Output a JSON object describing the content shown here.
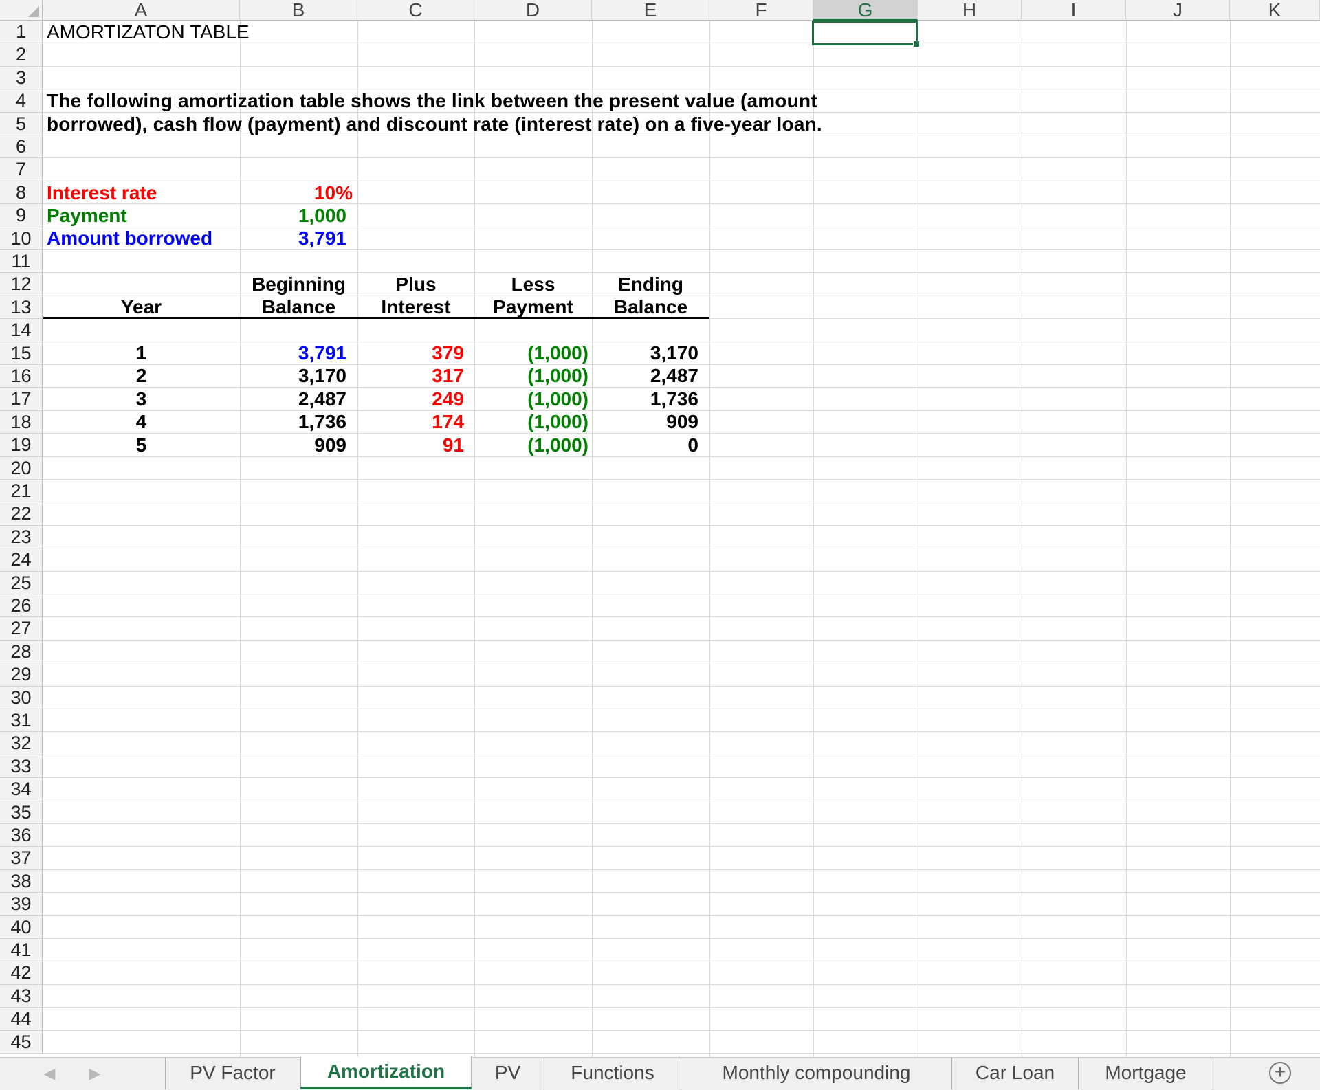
{
  "columns": [
    "A",
    "B",
    "C",
    "D",
    "E",
    "F",
    "G",
    "H",
    "I",
    "J",
    "K"
  ],
  "selected_column": "G",
  "rows": [
    "1",
    "2",
    "3",
    "4",
    "5",
    "6",
    "7",
    "8",
    "9",
    "10",
    "11",
    "12",
    "13",
    "14",
    "15",
    "16",
    "17",
    "18",
    "19",
    "20",
    "21",
    "22",
    "23",
    "24",
    "25",
    "26",
    "27",
    "28",
    "29",
    "30",
    "31",
    "32",
    "33",
    "34",
    "35",
    "36",
    "37",
    "38",
    "39",
    "40",
    "41",
    "42",
    "43",
    "44",
    "45"
  ],
  "sheet": {
    "title": "AMORTIZATON TABLE",
    "description_line1": "The following amortization table shows the link between the present value (amount",
    "description_line2": "borrowed), cash flow (payment) and discount rate (interest rate) on a five-year loan.",
    "inputs": {
      "interest_rate_label": "Interest rate",
      "interest_rate_value": "10%",
      "payment_label": "Payment",
      "payment_value": "1,000",
      "amount_borrowed_label": "Amount borrowed",
      "amount_borrowed_value": "3,791"
    },
    "table_headers": {
      "year": "Year",
      "beginning_top": "Beginning",
      "beginning_bottom": "Balance",
      "interest_top": "Plus",
      "interest_bottom": "Interest",
      "payment_top": "Less",
      "payment_bottom": "Payment",
      "ending_top": "Ending",
      "ending_bottom": "Balance"
    },
    "table_rows": [
      {
        "year": "1",
        "beginning": "3,791",
        "interest": "379",
        "payment": "(1,000)",
        "ending": "3,170"
      },
      {
        "year": "2",
        "beginning": "3,170",
        "interest": "317",
        "payment": "(1,000)",
        "ending": "2,487"
      },
      {
        "year": "3",
        "beginning": "2,487",
        "interest": "249",
        "payment": "(1,000)",
        "ending": "1,736"
      },
      {
        "year": "4",
        "beginning": "1,736",
        "interest": "174",
        "payment": "(1,000)",
        "ending": "909"
      },
      {
        "year": "5",
        "beginning": "909",
        "interest": "91",
        "payment": "(1,000)",
        "ending": "0"
      }
    ]
  },
  "tabs": [
    {
      "label": "PV Factor",
      "active": false
    },
    {
      "label": "Amortization",
      "active": true
    },
    {
      "label": "PV",
      "active": false
    },
    {
      "label": "Functions",
      "active": false
    },
    {
      "label": "Monthly compounding",
      "active": false
    },
    {
      "label": "Car Loan",
      "active": false
    },
    {
      "label": "Mortgage",
      "active": false
    }
  ],
  "icons": {
    "prev": "nav-prev-icon",
    "next": "nav-next-icon",
    "add": "add-sheet-icon"
  },
  "colors": {
    "accent": "#217346",
    "interest": "#ff0000",
    "payment": "#008000",
    "borrowed": "#0000ff"
  }
}
